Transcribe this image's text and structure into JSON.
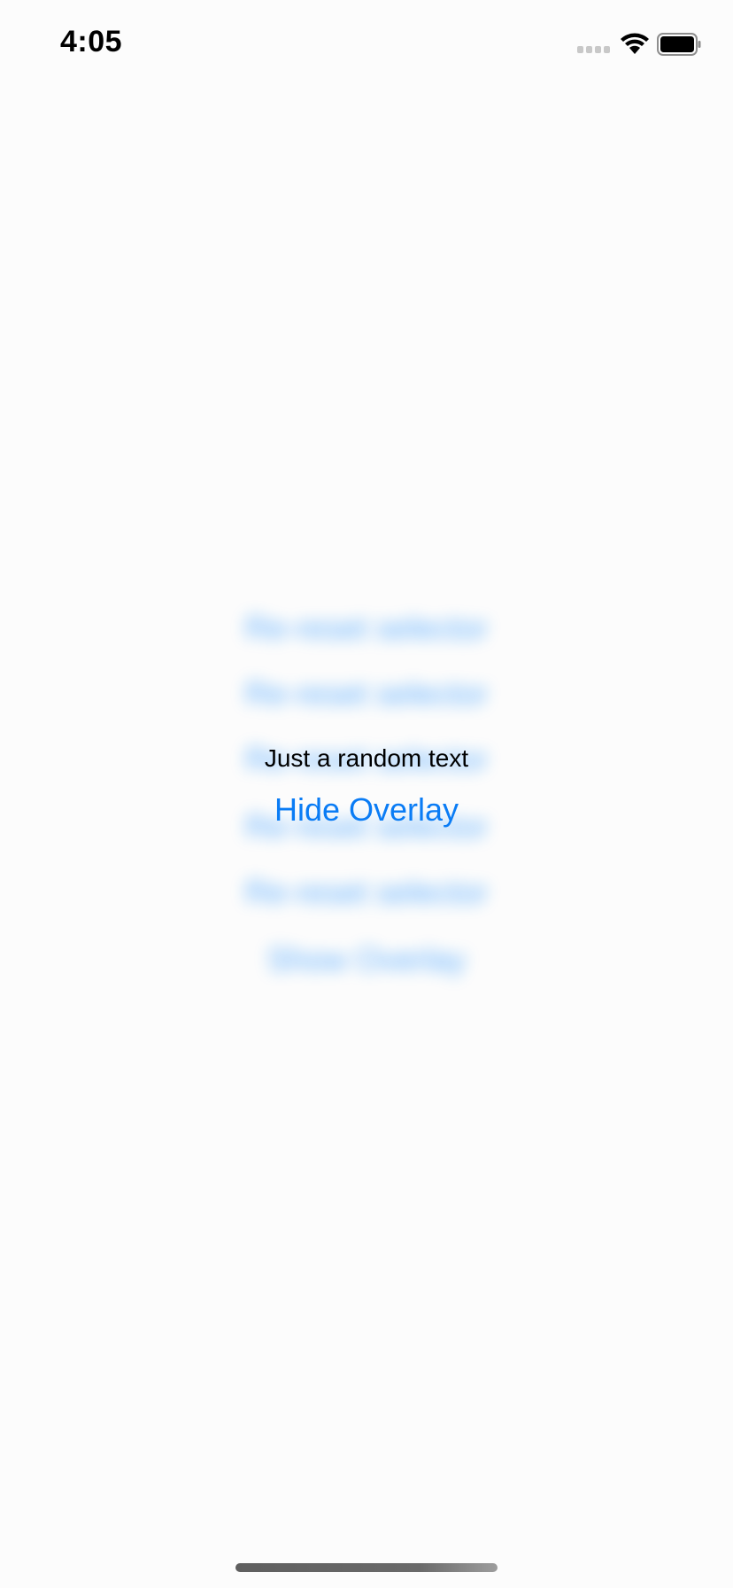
{
  "status_bar": {
    "time": "4:05",
    "icons": [
      "cellular-signal-icon",
      "wifi-icon",
      "battery-icon"
    ]
  },
  "background_list": {
    "rows": [
      "Re-reset selector",
      "Re-reset selector",
      "Re-reset selector",
      "Re-reset selector",
      "Re-reset selector",
      "Show Overlay"
    ],
    "color": "#0a84ff"
  },
  "overlay": {
    "text": "Just a random text",
    "button_label": "Hide Overlay",
    "button_color": "#0a7cf5"
  }
}
